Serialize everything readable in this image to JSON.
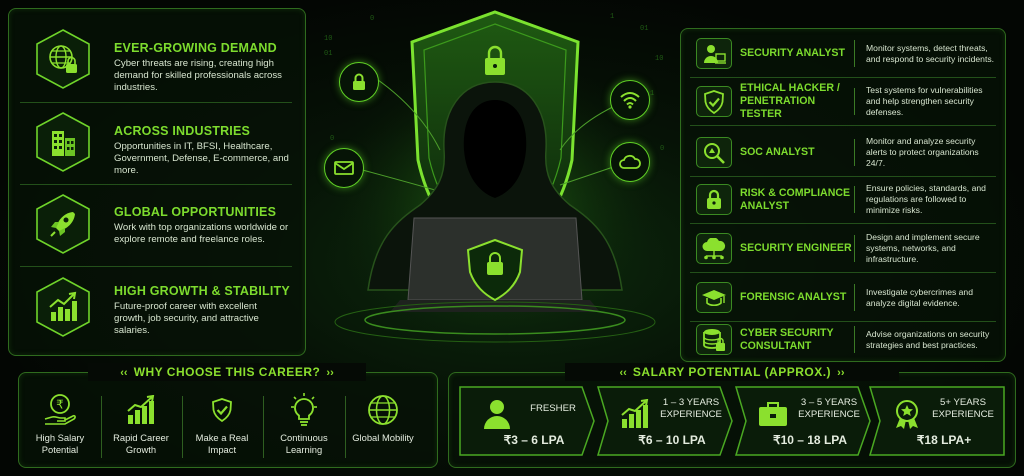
{
  "features": [
    {
      "title": "EVER-GROWING DEMAND",
      "desc": "Cyber threats are rising, creating high demand for skilled professionals across industries.",
      "icon": "globe-lock-icon"
    },
    {
      "title": "ACROSS INDUSTRIES",
      "desc": "Opportunities in IT, BFSI, Healthcare, Government, Defense, E-commerce, and more.",
      "icon": "buildings-icon"
    },
    {
      "title": "GLOBAL OPPORTUNITIES",
      "desc": "Work with top organizations worldwide or explore remote and freelance roles.",
      "icon": "rocket-icon"
    },
    {
      "title": "HIGH GROWTH & STABILITY",
      "desc": "Future-proof career with excellent growth, job security, and attractive salaries.",
      "icon": "growth-chart-icon"
    }
  ],
  "roles": [
    {
      "title": "SECURITY ANALYST",
      "desc": "Monitor systems, detect threats, and respond to security incidents.",
      "icon": "analyst-icon"
    },
    {
      "title": "ETHICAL HACKER / PENETRATION TESTER",
      "desc": "Test systems for vulnerabilities and help strengthen security defenses.",
      "icon": "shield-check-icon"
    },
    {
      "title": "SOC ANALYST",
      "desc": "Monitor and analyze security alerts to protect organizations 24/7.",
      "icon": "magnifier-icon"
    },
    {
      "title": "RISK & COMPLIANCE ANALYST",
      "desc": "Ensure policies, standards, and regulations are followed to minimize risks.",
      "icon": "padlock-icon"
    },
    {
      "title": "SECURITY ENGINEER",
      "desc": "Design and implement secure systems, networks, and infrastructure.",
      "icon": "cloud-network-icon"
    },
    {
      "title": "FORENSIC ANALYST",
      "desc": "Investigate cybercrimes and analyze digital evidence.",
      "icon": "graduation-cap-icon"
    },
    {
      "title": "CYBER SECURITY CONSULTANT",
      "desc": "Advise organizations on security strategies and best practices.",
      "icon": "database-lock-icon"
    }
  ],
  "why": {
    "heading": "WHY CHOOSE THIS CAREER?",
    "items": [
      {
        "label": "High Salary Potential",
        "icon": "rupee-hand-icon"
      },
      {
        "label": "Rapid Career Growth",
        "icon": "bar-growth-icon"
      },
      {
        "label": "Make a Real Impact",
        "icon": "shield-check-icon"
      },
      {
        "label": "Continuous Learning",
        "icon": "lightbulb-icon"
      },
      {
        "label": "Global Mobility",
        "icon": "globe-icon"
      }
    ]
  },
  "salary": {
    "heading": "SALARY POTENTIAL (APPROX.)",
    "tiers": [
      {
        "level": "FRESHER",
        "range": "₹3 – 6 LPA",
        "icon": "user-icon"
      },
      {
        "level": "1 – 3 YEARS EXPERIENCE",
        "range": "₹6 – 10 LPA",
        "icon": "bar-growth-icon"
      },
      {
        "level": "3 – 5 YEARS EXPERIENCE",
        "range": "₹10 – 18 LPA",
        "icon": "briefcase-icon"
      },
      {
        "level": "5+ YEARS EXPERIENCE",
        "range": "₹18 LPA+",
        "icon": "award-badge-icon"
      }
    ]
  },
  "colors": {
    "accent": "#7ddc2e",
    "panel_border": "#2f6b1e",
    "background": "#050805"
  }
}
